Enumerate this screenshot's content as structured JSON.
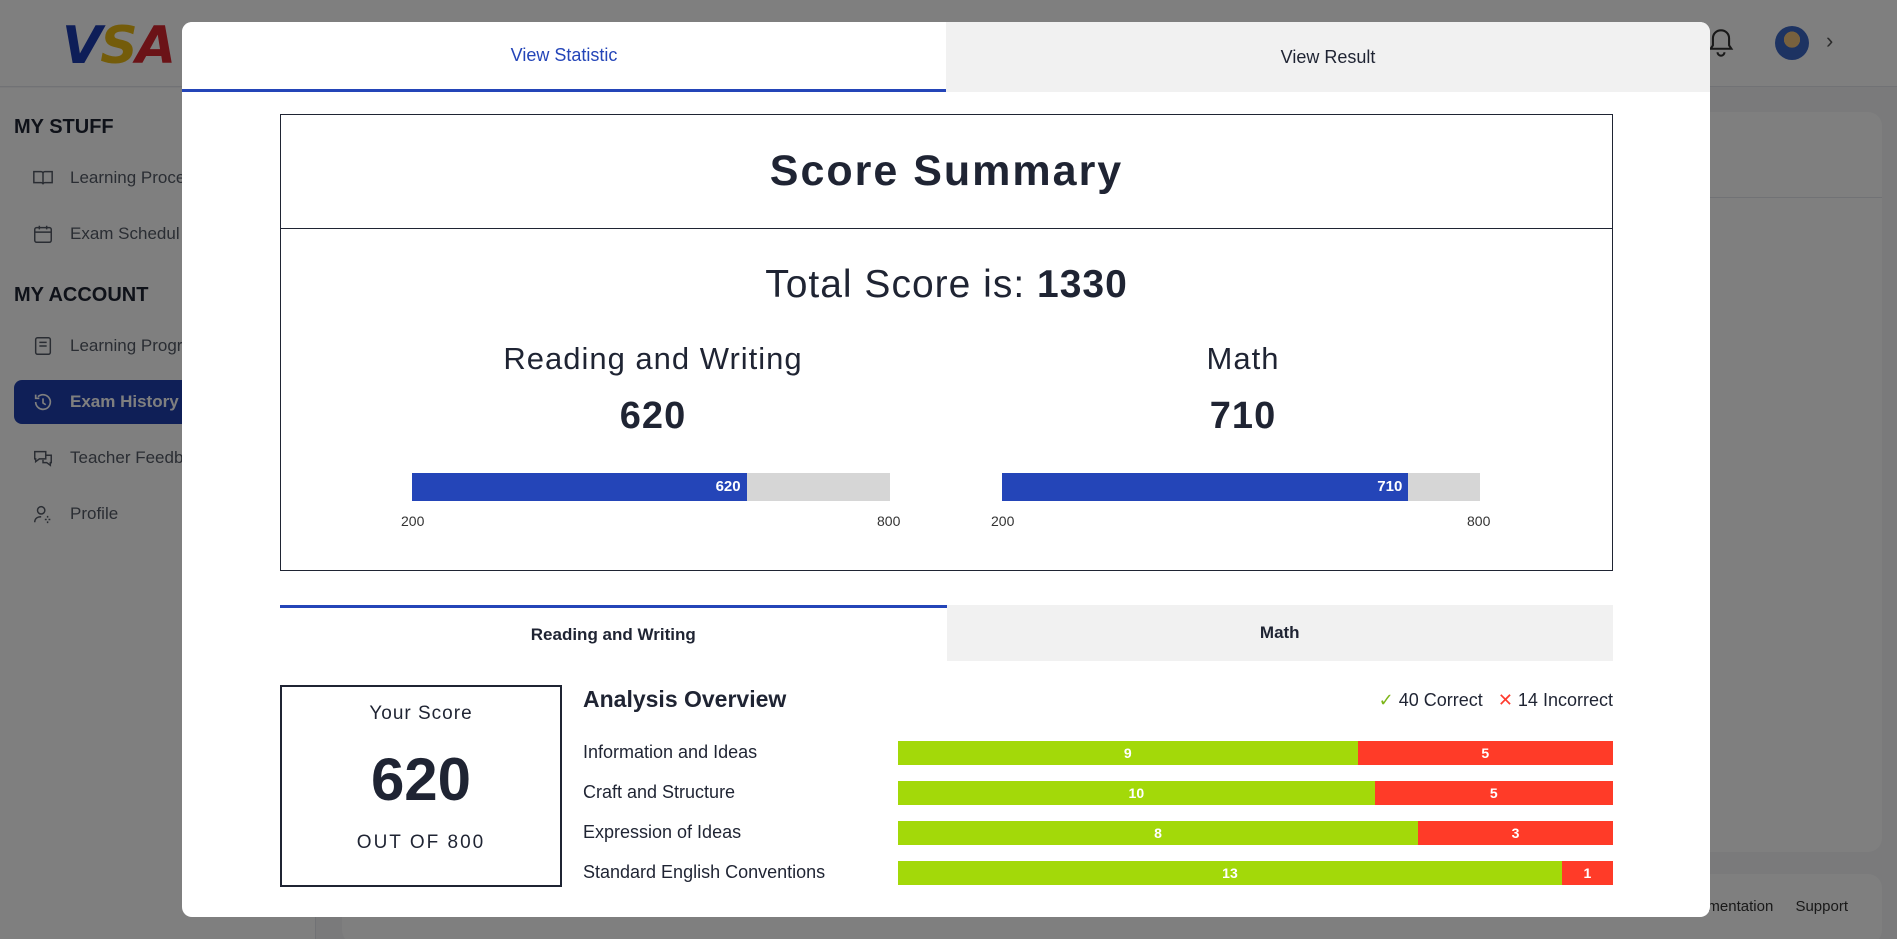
{
  "app": {
    "logo": {
      "v": "V",
      "s": "S",
      "a": "A"
    },
    "sidebar": {
      "sections": [
        {
          "heading": "MY STUFF",
          "items": [
            {
              "label": "Learning Proce",
              "icon": "book-icon"
            },
            {
              "label": "Exam Schedul",
              "icon": "calendar-icon"
            }
          ]
        },
        {
          "heading": "MY ACCOUNT",
          "items": [
            {
              "label": "Learning Progr",
              "icon": "notebook-icon"
            },
            {
              "label": "Exam History",
              "icon": "history-icon",
              "active": true
            },
            {
              "label": "Teacher Feedb",
              "icon": "chat-icon"
            },
            {
              "label": "Profile",
              "icon": "user-settings-icon"
            }
          ]
        }
      ]
    },
    "footer": {
      "links": [
        "mentation",
        "Support"
      ]
    }
  },
  "modal": {
    "tabs": [
      {
        "label": "View Statistic",
        "active": true
      },
      {
        "label": "View Result",
        "active": false
      }
    ],
    "summary": {
      "title": "Score Summary",
      "total_prefix": "Total Score is:",
      "total_value": "1330",
      "sections": [
        {
          "name": "Reading and Writing",
          "score": "620",
          "bar_label": "620",
          "min": "200",
          "max": "800",
          "value": 620
        },
        {
          "name": "Math",
          "score": "710",
          "bar_label": "710",
          "min": "200",
          "max": "800",
          "value": 710
        }
      ]
    },
    "subtabs": [
      {
        "label": "Reading and Writing",
        "active": true
      },
      {
        "label": "Math",
        "active": false
      }
    ],
    "your_score": {
      "label": "Your Score",
      "value": "620",
      "out_of": "OUT OF 800"
    },
    "analysis": {
      "title": "Analysis Overview",
      "correct_count": "40",
      "correct_label": "Correct",
      "incorrect_count": "14",
      "incorrect_label": "Incorrect",
      "colors": {
        "correct": "#a3d909",
        "incorrect": "#ff3b28",
        "accent": "#2445b8"
      }
    },
    "chart_data": {
      "type": "bar",
      "categories": [
        "Information and Ideas",
        "Craft and Structure",
        "Expression of Ideas",
        "Standard English Conventions"
      ],
      "series": [
        {
          "name": "Correct",
          "values": [
            9,
            10,
            8,
            13
          ]
        },
        {
          "name": "Incorrect",
          "values": [
            5,
            5,
            3,
            1
          ]
        }
      ]
    }
  }
}
